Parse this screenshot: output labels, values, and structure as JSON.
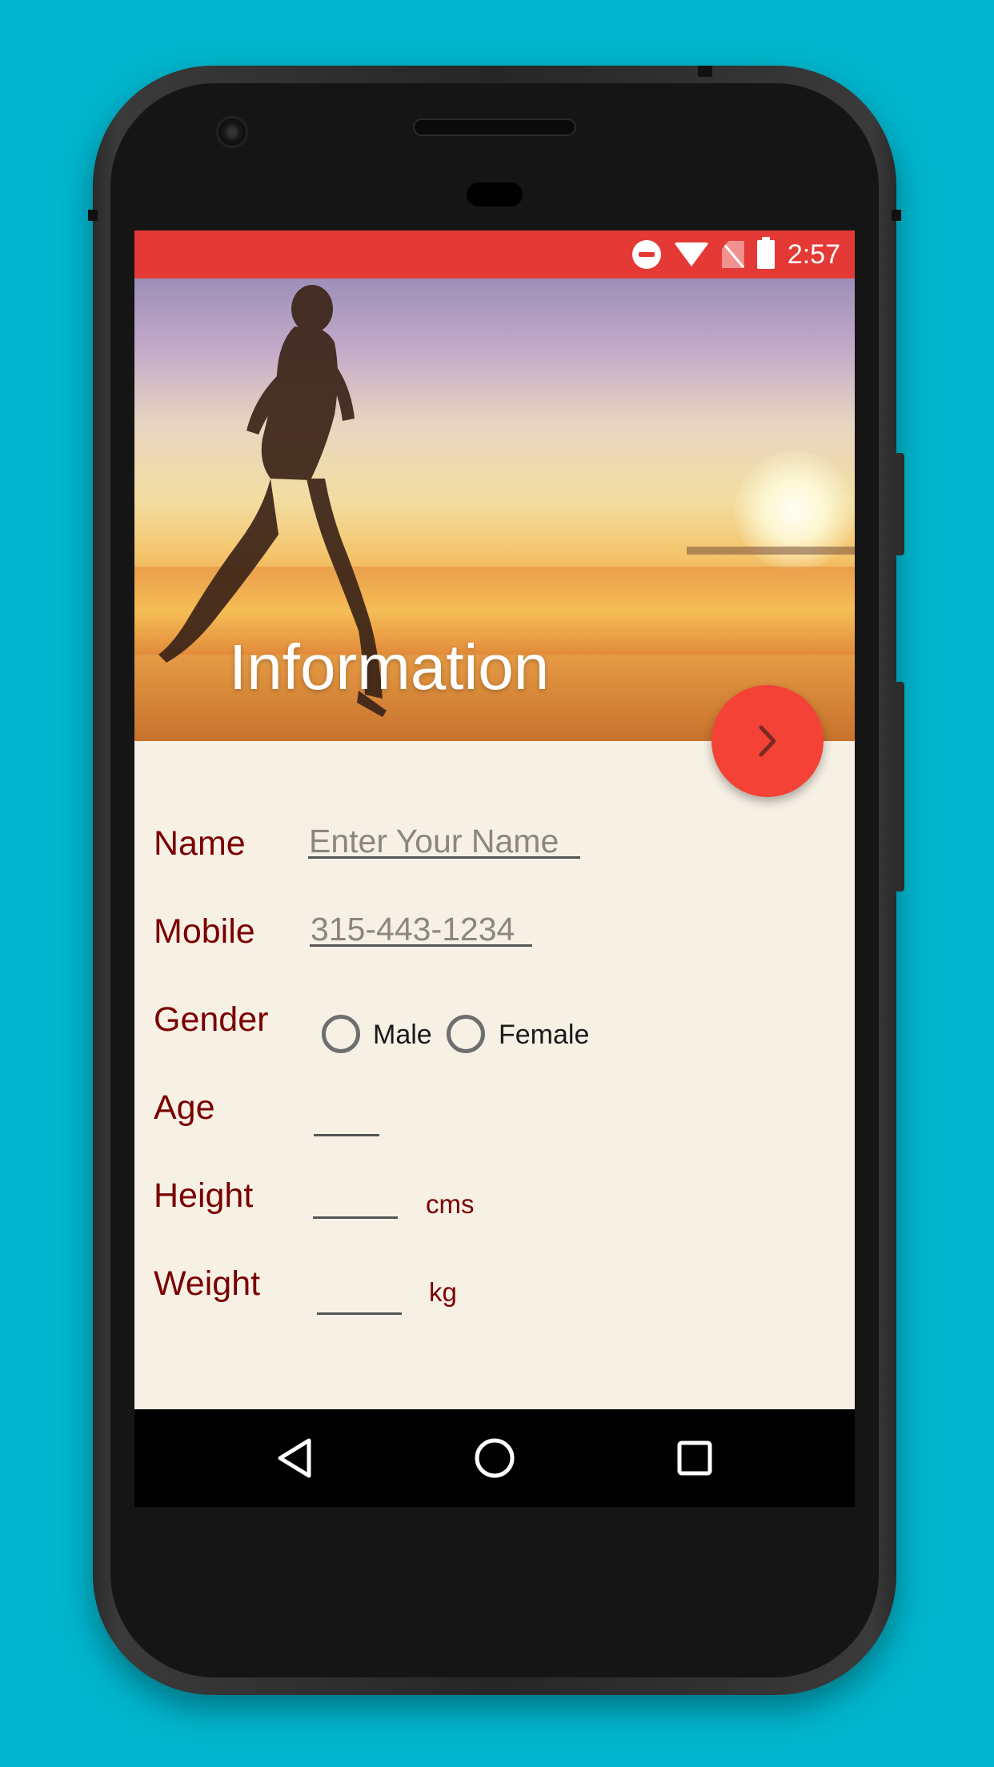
{
  "status_bar": {
    "time": "2:57",
    "icons": [
      "do-not-disturb-icon",
      "wifi-icon",
      "no-sim-icon",
      "battery-icon"
    ],
    "color": "#E53935"
  },
  "header": {
    "title": "Information"
  },
  "fab": {
    "icon": "chevron-right-icon",
    "color": "#F44336"
  },
  "form": {
    "name": {
      "label": "Name",
      "placeholder": "Enter Your Name"
    },
    "mobile": {
      "label": "Mobile",
      "placeholder": "315-443-1234"
    },
    "gender": {
      "label": "Gender",
      "options": [
        "Male",
        "Female"
      ]
    },
    "age": {
      "label": "Age",
      "value": ""
    },
    "height": {
      "label": "Height",
      "value": "",
      "unit": "cms"
    },
    "weight": {
      "label": "Weight",
      "value": "",
      "unit": "kg"
    }
  },
  "nav_bar": {
    "buttons": [
      "back-icon",
      "home-icon",
      "recents-icon"
    ]
  },
  "colors": {
    "background": "#00B5CD",
    "label": "#7A0000",
    "form_background": "#F7F1E5"
  }
}
